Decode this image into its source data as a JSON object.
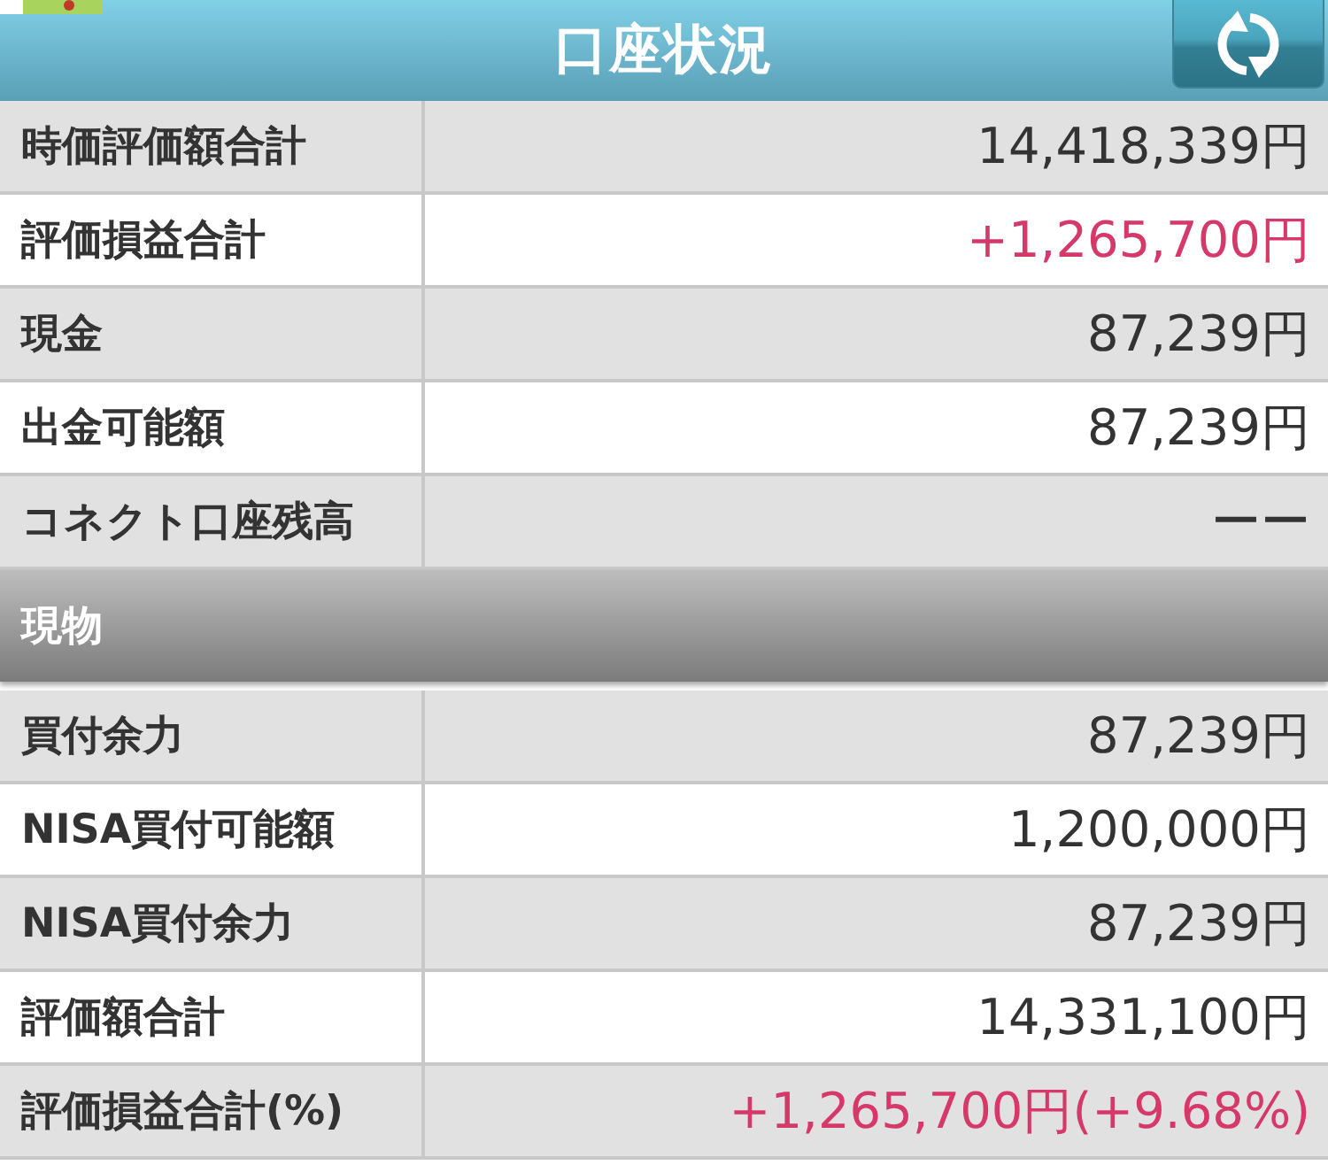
{
  "header": {
    "title": "口座状況"
  },
  "summary": {
    "rows": [
      {
        "label": "時価評価額合計",
        "value": "14,418,339円",
        "kind": "plain"
      },
      {
        "label": "評価損益合計",
        "value": "+1,265,700円",
        "kind": "gain"
      },
      {
        "label": "現金",
        "value": "87,239円",
        "kind": "plain"
      },
      {
        "label": "出金可能額",
        "value": "87,239円",
        "kind": "plain"
      },
      {
        "label": "コネクト口座残高",
        "value": "ーー",
        "kind": "plain"
      }
    ]
  },
  "section": {
    "title": "現物",
    "rows": [
      {
        "label": "買付余力",
        "value": "87,239円",
        "kind": "plain"
      },
      {
        "label": "NISA買付可能額",
        "value": "1,200,000円",
        "kind": "plain"
      },
      {
        "label": "NISA買付余力",
        "value": "87,239円",
        "kind": "plain"
      },
      {
        "label": "評価額合計",
        "value": "14,331,100円",
        "kind": "plain"
      },
      {
        "label": "評価損益合計(%)",
        "value": "+1,265,700円(+9.68%)",
        "kind": "gain"
      }
    ]
  }
}
